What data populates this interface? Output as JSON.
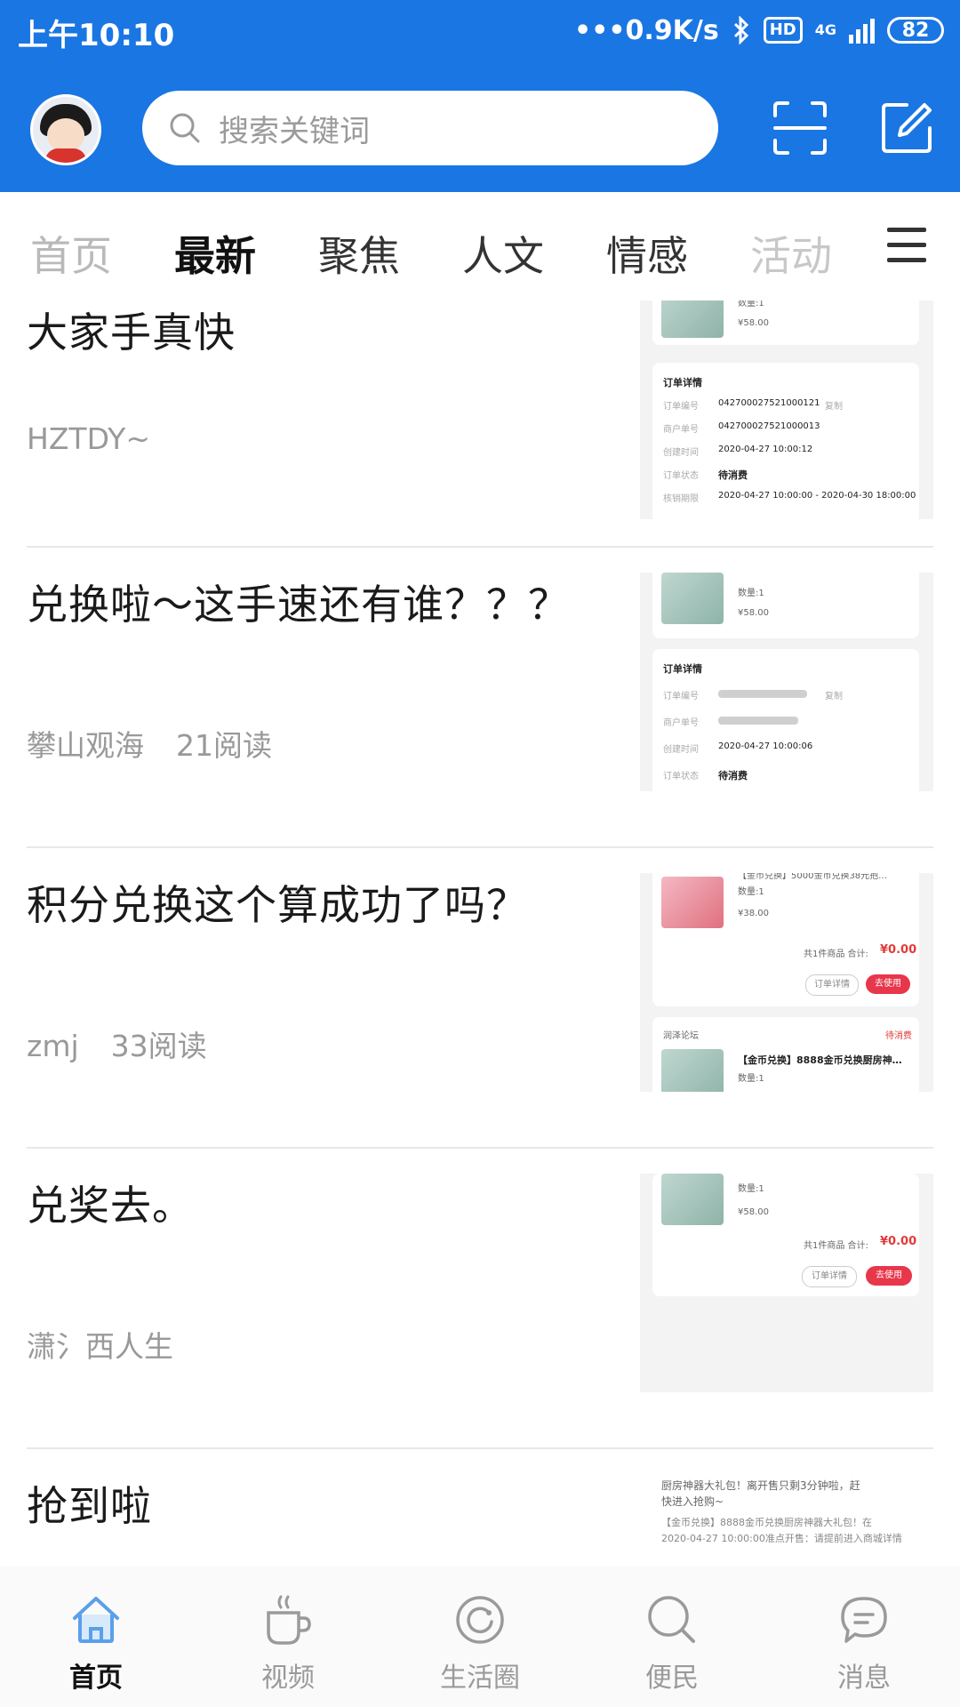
{
  "status_bar": {
    "time": "上午10:10",
    "speed": "•••0.9K/s",
    "hd": "HD",
    "net": "4G",
    "battery": "82"
  },
  "header": {
    "search_placeholder": "搜索关键词",
    "avatar": "avatar",
    "scan_icon": "scan-icon",
    "edit_icon": "edit-icon",
    "accent_color": "#1a76e3"
  },
  "tabs": [
    {
      "label": "首页"
    },
    {
      "label": "最新"
    },
    {
      "label": "聚焦"
    },
    {
      "label": "人文"
    },
    {
      "label": "情感"
    },
    {
      "label": "活动"
    }
  ],
  "active_tab": "最新",
  "feed": [
    {
      "title": "大家手真快",
      "author": "HZTDY~",
      "reads": "",
      "thumb": {
        "qty": "数量:1",
        "price": "¥58.00",
        "heading": "订单详情",
        "rows": [
          {
            "k": "订单编号",
            "v": "042700027521000121",
            "tag": "复制"
          },
          {
            "k": "商户单号",
            "v": "042700027521000013"
          },
          {
            "k": "创建时间",
            "v": "2020-04-27 10:00:12"
          },
          {
            "k": "订单状态",
            "v": "待消费"
          },
          {
            "k": "核销期限",
            "v": "2020-04-27 10:00:00 - 2020-04-30 18:00:00"
          }
        ]
      }
    },
    {
      "title": "兑换啦～这手速还有谁？？？",
      "author": "攀山观海",
      "reads": "21阅读",
      "thumb": {
        "qty": "数量:1",
        "price": "¥58.00",
        "heading": "订单详情",
        "rows": [
          {
            "k": "订单编号",
            "tag": "复制"
          },
          {
            "k": "商户单号"
          },
          {
            "k": "创建时间",
            "v": "2020-04-27 10:00:06"
          },
          {
            "k": "订单状态",
            "v": "待消费"
          }
        ]
      }
    },
    {
      "title": "积分兑换这个算成功了吗？",
      "author": "zmj",
      "reads": "33阅读",
      "thumb": {
        "top_line": "【金币兑换】5000金币兑换38元抱…",
        "qty": "数量:1",
        "price": "¥38.00",
        "total_label": "共1件商品  合计:",
        "total": "¥0.00",
        "btn_detail": "订单详情",
        "btn_use": "去使用",
        "shop": "润泽论坛",
        "status": "待消费",
        "item2": "【金币兑换】8888金币兑换厨房神…",
        "qty2": "数量:1"
      }
    },
    {
      "title": "兑奖去。",
      "author": "潇氵西人生",
      "reads": "",
      "thumb": {
        "qty": "数量:1",
        "price": "¥58.00",
        "total_label": "共1件商品  合计:",
        "total": "¥0.00",
        "btn_detail": "订单详情",
        "btn_use": "去使用"
      }
    },
    {
      "title": "抢到啦",
      "author": "",
      "reads": "",
      "thumb": {
        "line1": "厨房神器大礼包！离开售只剩3分钟啦，赶",
        "line2": "快进入抢购~",
        "line3": "【金币兑换】8888金币兑换厨房神器大礼包！在",
        "line4": "2020-04-27 10:00:00准点开售：请提前进入商城详情"
      }
    }
  ],
  "bottom_nav": [
    {
      "label": "首页",
      "icon": "home-icon"
    },
    {
      "label": "视频",
      "icon": "coffee-cup-icon"
    },
    {
      "label": "生活圈",
      "icon": "circle-refresh-icon"
    },
    {
      "label": "便民",
      "icon": "search-icon"
    },
    {
      "label": "消息",
      "icon": "chat-bubble-icon"
    }
  ]
}
